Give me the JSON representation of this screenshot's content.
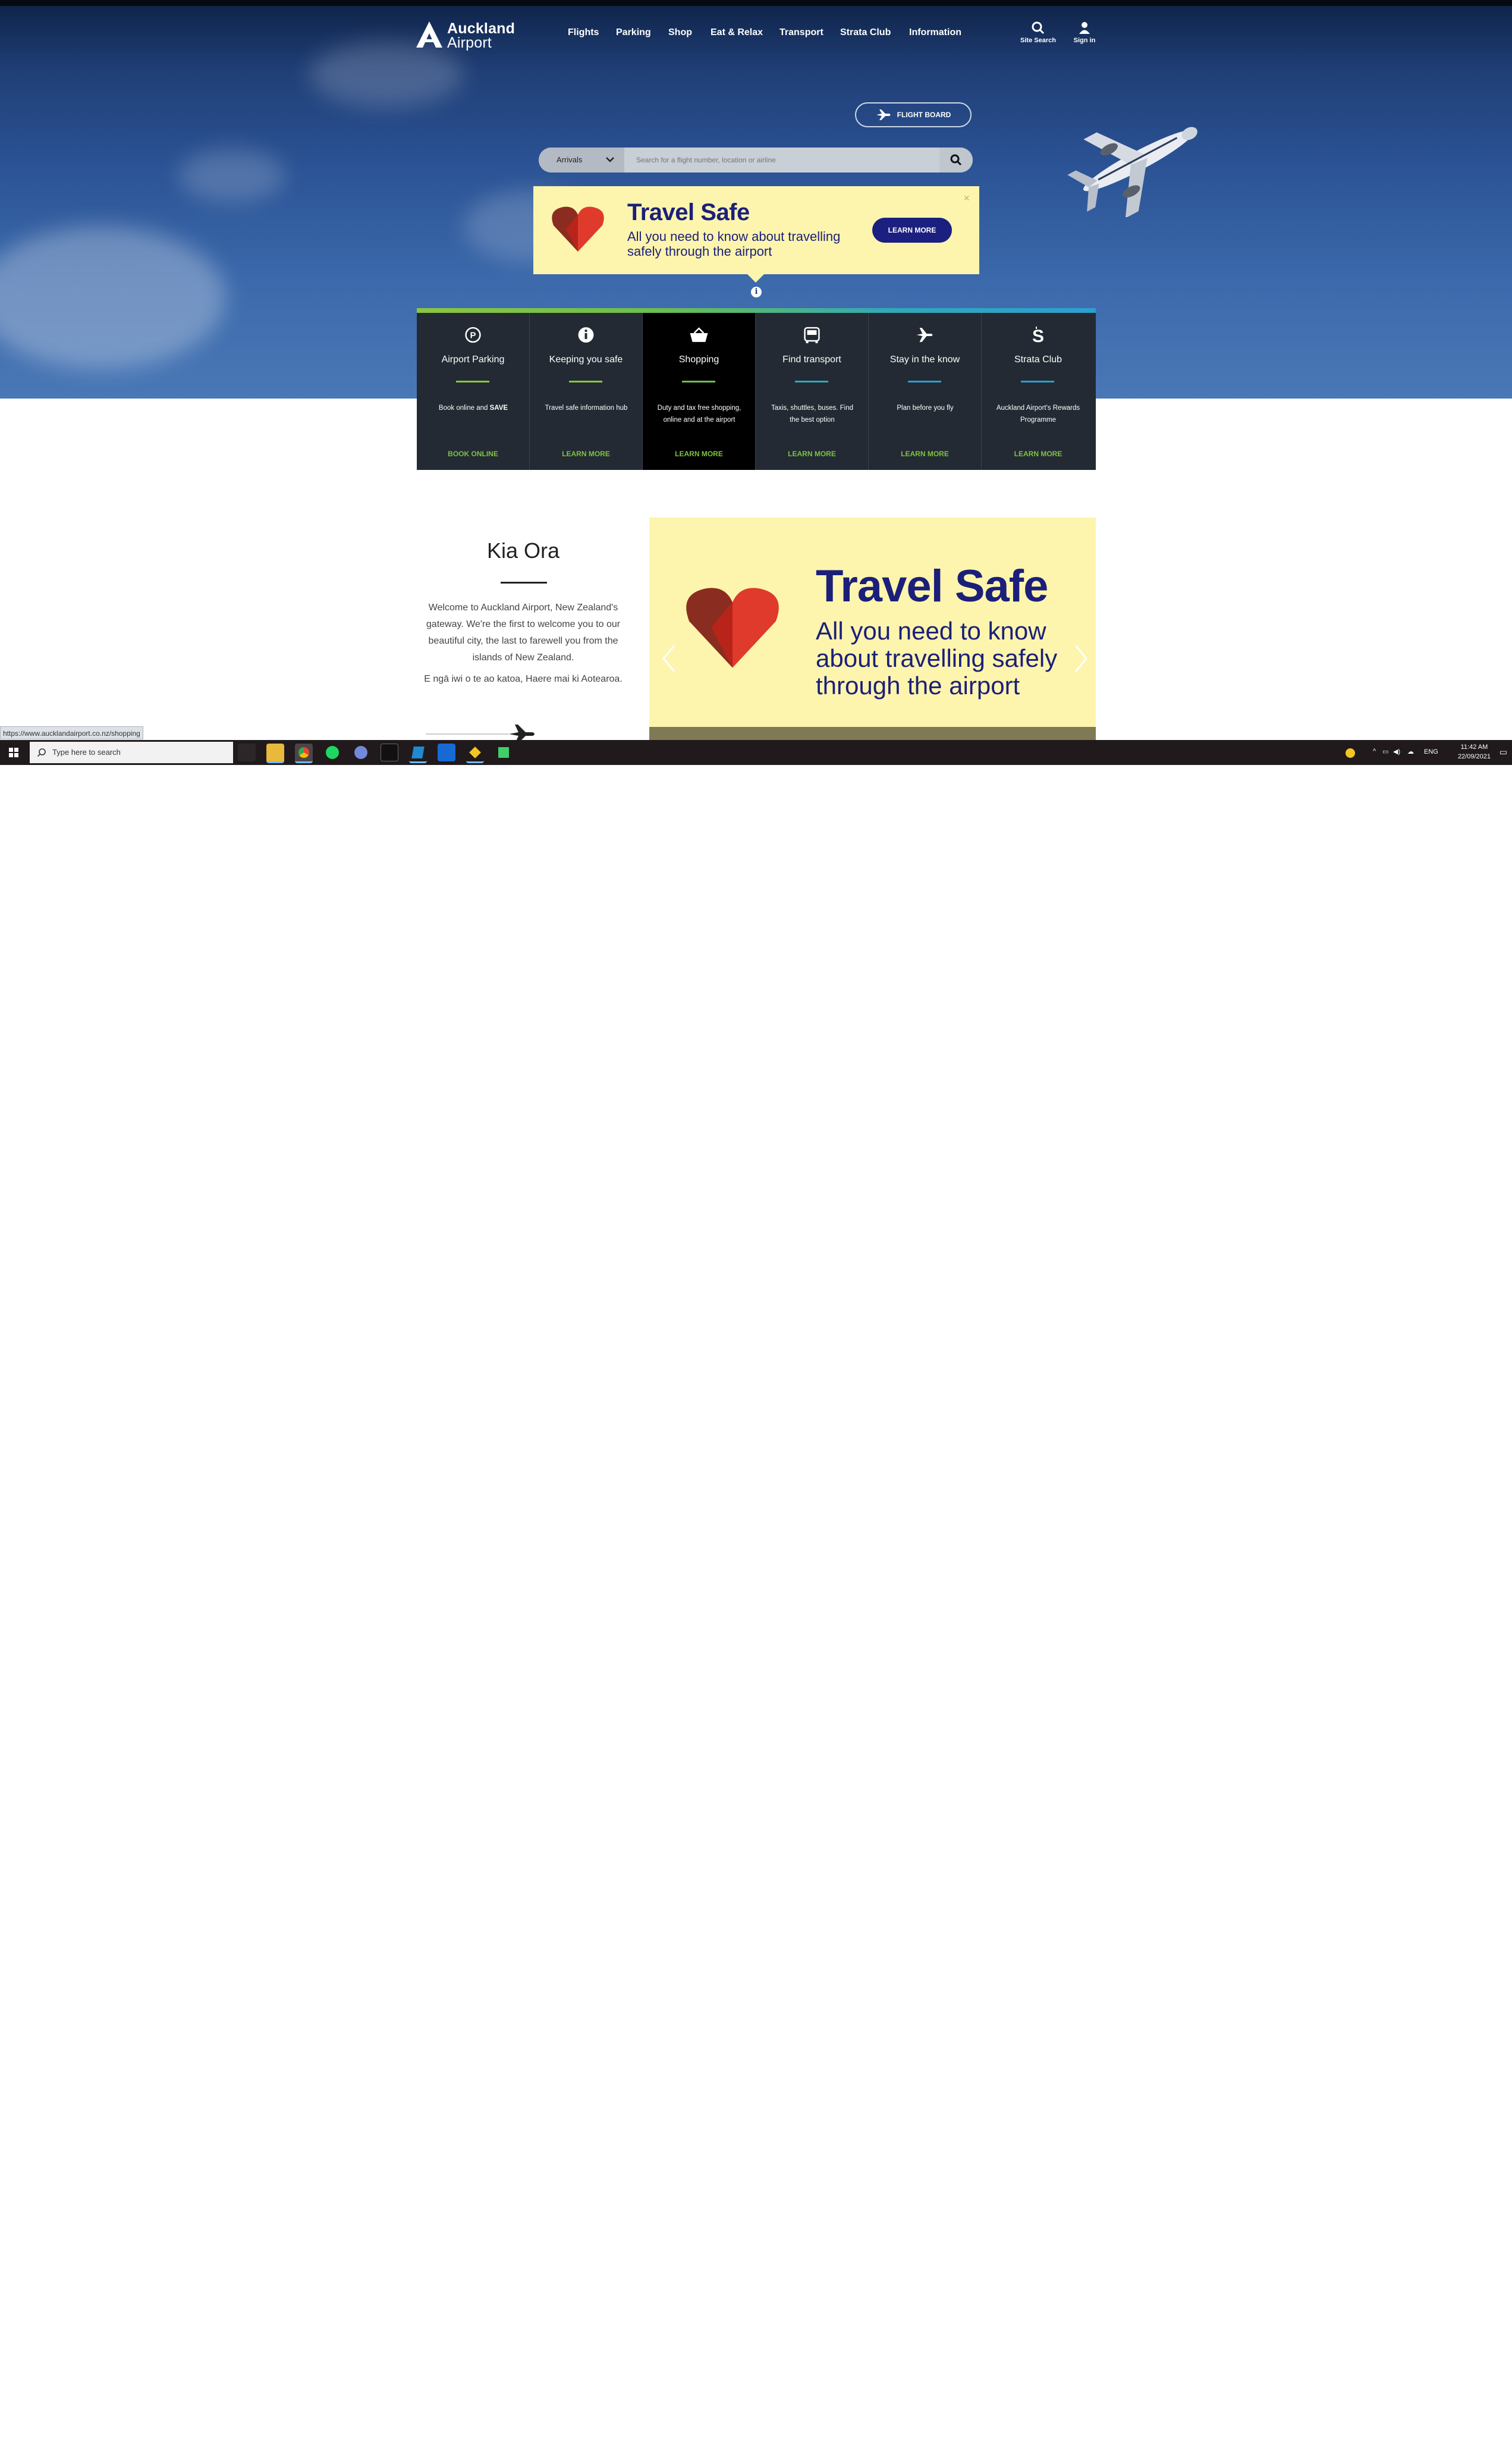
{
  "header": {
    "logo_line1": "Auckland",
    "logo_line2": "Airport",
    "nav": [
      "Flights",
      "Parking",
      "Shop",
      "Eat & Relax",
      "Transport",
      "Strata Club",
      "Information"
    ],
    "site_search": "Site Search",
    "sign_in": "Sign in"
  },
  "flight_board": {
    "label": "FLIGHT BOARD"
  },
  "search": {
    "mode": "Arrivals",
    "placeholder": "Search for a flight number, location or airline"
  },
  "banner": {
    "title": "Travel Safe",
    "subtitle": "All you need to know about travelling safely through the airport",
    "button": "LEARN MORE",
    "close": "×"
  },
  "quick_links": [
    {
      "icon": "parking-icon",
      "title": "Airport Parking",
      "desc_pre": "Book online and ",
      "desc_bold": "SAVE",
      "link": "BOOK ONLINE",
      "accent": "#8cc63f"
    },
    {
      "icon": "info-icon",
      "title": "Keeping you safe",
      "desc_pre": "Travel safe information hub",
      "desc_bold": "",
      "link": "LEARN MORE",
      "accent": "#8cc63f"
    },
    {
      "icon": "shopping-basket-icon",
      "title": "Shopping",
      "desc_pre": "Duty and tax free shopping, online and at the airport",
      "desc_bold": "",
      "link": "LEARN MORE",
      "accent": "#6cbf4c"
    },
    {
      "icon": "bus-icon",
      "title": "Find transport",
      "desc_pre": "Taxis, shuttles, buses. Find the best option",
      "desc_bold": "",
      "link": "LEARN MORE",
      "accent": "#31a9b8"
    },
    {
      "icon": "plane-icon",
      "title": "Stay in the know",
      "desc_pre": "Plan before you fly",
      "desc_bold": "",
      "link": "LEARN MORE",
      "accent": "#2d9fd0"
    },
    {
      "icon": "strata-s-icon",
      "title": "Strata Club",
      "desc_pre": "Auckland Airport's Rewards Programme",
      "desc_bold": "",
      "link": "LEARN MORE",
      "accent": "#2d9fd0"
    }
  ],
  "kia_ora": {
    "title": "Kia Ora",
    "body": "Welcome to Auckland Airport, New Zealand's gateway. We're the first to welcome you to our beautiful city, the last to farewell you from the islands of New Zealand.",
    "body2": "E ngā iwi o te ao katoa, Haere mai ki Aotearoa."
  },
  "carousel": {
    "title": "Travel Safe",
    "subtitle": "All you need to know about travelling safely through the airport"
  },
  "status_url": "https://www.aucklandairport.co.nz/shopping",
  "taskbar": {
    "search_placeholder": "Type here to search",
    "language": "ENG",
    "time": "11:42 AM",
    "date": "22/09/2021"
  },
  "colors": {
    "navy": "#1b1f7a",
    "banner_yellow": "#fdf5ad",
    "tile_bg": "#232a33",
    "link_green": "#7dc242"
  }
}
